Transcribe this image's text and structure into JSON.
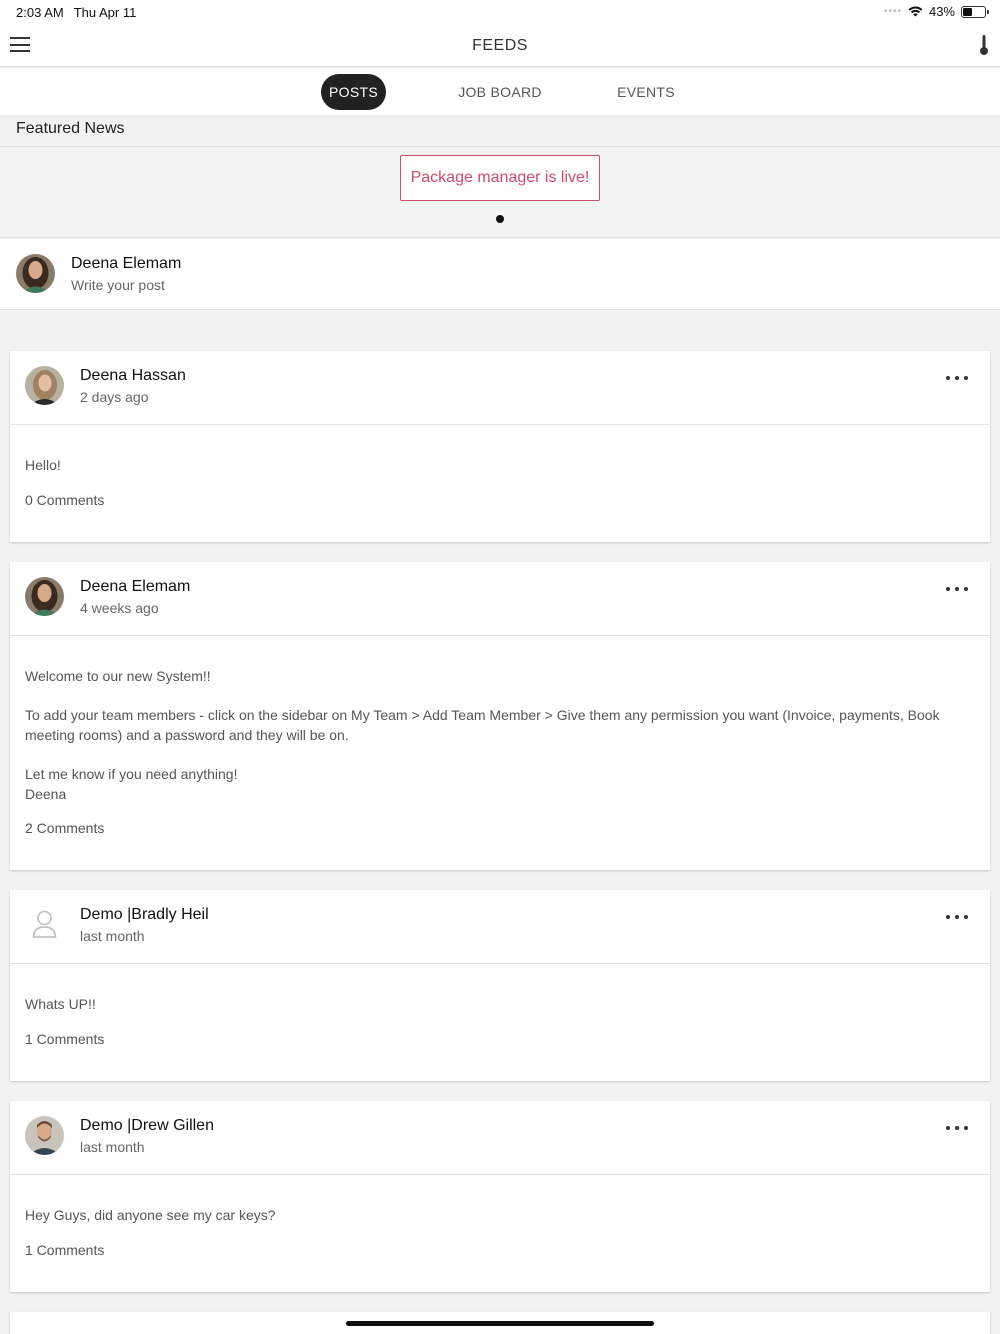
{
  "status": {
    "time": "2:03 AM",
    "date": "Thu Apr 11",
    "battery": "43%",
    "battery_level": 0.43
  },
  "nav": {
    "title": "FEEDS"
  },
  "tabs": [
    {
      "label": "POSTS",
      "active": true
    },
    {
      "label": "JOB BOARD",
      "active": false
    },
    {
      "label": "EVENTS",
      "active": false
    }
  ],
  "featured": {
    "title": "Featured News",
    "item": "Package manager is live!",
    "accent": "#d04a6a"
  },
  "composer": {
    "name": "Deena Elemam",
    "hint": "Write your post"
  },
  "posts": [
    {
      "author": "Deena Hassan",
      "time": "2 days ago",
      "body": [
        "Hello!"
      ],
      "comments": "0 Comments"
    },
    {
      "author": "Deena Elemam",
      "time": "4 weeks ago",
      "body": [
        "Welcome to our new System!!",
        "To add your team members - click on the sidebar on My Team > Add Team Member > Give them any permission you want (Invoice, payments, Book meeting rooms) and a password and they will be on.",
        "Let me know if you need anything!",
        "Deena"
      ],
      "comments": "2 Comments"
    },
    {
      "author": "Demo |Bradly Heil",
      "time": "last month",
      "body": [
        "Whats UP!!"
      ],
      "comments": "1 Comments"
    },
    {
      "author": "Demo |Drew Gillen",
      "time": "last month",
      "body": [
        "Hey Guys, did anyone see my car keys?"
      ],
      "comments": "1 Comments"
    }
  ]
}
